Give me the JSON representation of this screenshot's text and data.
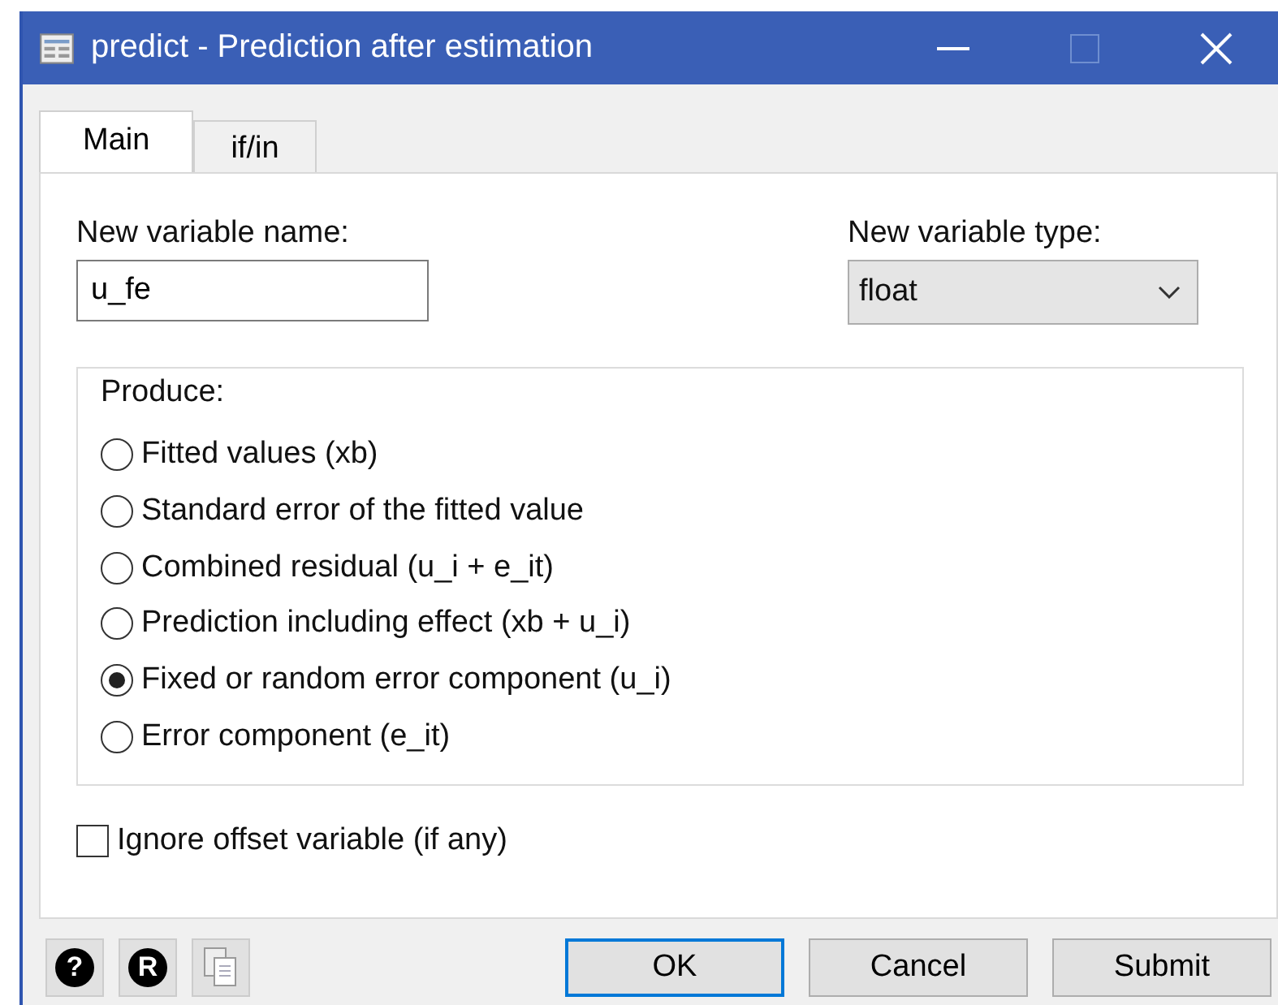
{
  "window": {
    "title": "predict - Prediction after estimation"
  },
  "tabs": [
    {
      "label": "Main",
      "selected": true
    },
    {
      "label": "if/in",
      "selected": false
    }
  ],
  "new_variable_name": {
    "label": "New variable name:",
    "value": "u_fe"
  },
  "new_variable_type": {
    "label": "New variable type:",
    "value": "float"
  },
  "produce": {
    "label": "Produce:",
    "options": [
      {
        "label": "Fitted values (xb)",
        "selected": false
      },
      {
        "label": "Standard error of the fitted value",
        "selected": false
      },
      {
        "label": "Combined residual (u_i + e_it)",
        "selected": false
      },
      {
        "label": "Prediction including effect (xb + u_i)",
        "selected": false
      },
      {
        "label": "Fixed or random error component (u_i)",
        "selected": true
      },
      {
        "label": "Error component (e_it)",
        "selected": false
      }
    ]
  },
  "ignore_offset": {
    "label": "Ignore offset variable (if any)",
    "checked": false
  },
  "footer": {
    "help": "?",
    "reset": "R",
    "buttons": [
      "OK",
      "Cancel",
      "Submit"
    ]
  }
}
